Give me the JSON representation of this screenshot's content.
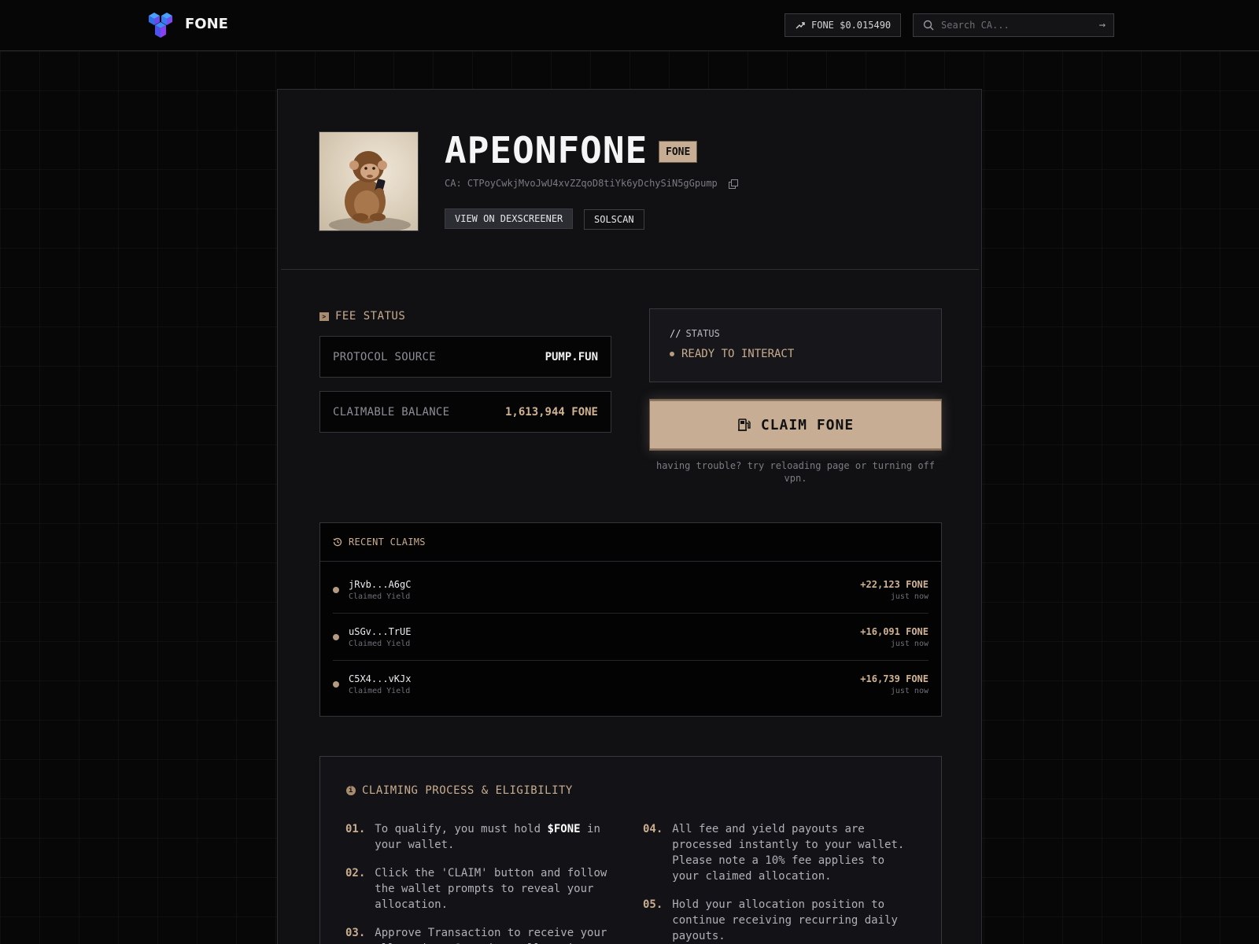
{
  "brand": {
    "name": "FONE"
  },
  "header": {
    "price_label": "FONE $0.015490",
    "search_placeholder": "Search CA..."
  },
  "token": {
    "name": "APEONFONE",
    "ticker": "FONE",
    "ca_line": "CA: CTPoyCwkjMvoJwU4xvZZqoD8tiYk6yDchySiN5gGpump",
    "buttons": {
      "dexscreener": "VIEW ON DEXSCREENER",
      "solscan": "SOLSCAN"
    }
  },
  "fee_status": {
    "title": "FEE STATUS",
    "protocol_label": "PROTOCOL SOURCE",
    "protocol_value": "PUMP.FUN",
    "balance_label": "CLAIMABLE BALANCE",
    "balance_value": "1,613,944 FONE"
  },
  "status": {
    "heading": "STATUS",
    "value": "READY TO INTERACT"
  },
  "claim": {
    "button_label": "CLAIM FONE",
    "trouble_text": "having trouble? try reloading page or turning off vpn."
  },
  "recent_claims": {
    "title": "RECENT CLAIMS",
    "items": [
      {
        "address": "jRvb...A6gC",
        "subtitle": "Claimed Yield",
        "amount": "+22,123 FONE",
        "time": "just now"
      },
      {
        "address": "uSGv...TrUE",
        "subtitle": "Claimed Yield",
        "amount": "+16,091 FONE",
        "time": "just now"
      },
      {
        "address": "C5X4...vKJx",
        "subtitle": "Claimed Yield",
        "amount": "+16,739 FONE",
        "time": "just now"
      }
    ]
  },
  "process": {
    "title": "CLAIMING PROCESS & ELIGIBILITY",
    "steps": [
      {
        "num": "01.",
        "pre": "To qualify, you must hold ",
        "highlight": "$FONE",
        "post": " in your wallet."
      },
      {
        "num": "02.",
        "text": "Click the 'CLAIM' button and follow the wallet prompts to reveal your allocation."
      },
      {
        "num": "03.",
        "text": "Approve Transaction to receive your allocation. Sometimes allocation"
      },
      {
        "num": "04.",
        "text": "All fee and yield payouts are processed instantly to your wallet. Please note a 10% fee applies to your claimed allocation."
      },
      {
        "num": "05.",
        "text": "Hold your allocation position to continue receiving recurring daily payouts."
      }
    ]
  }
}
